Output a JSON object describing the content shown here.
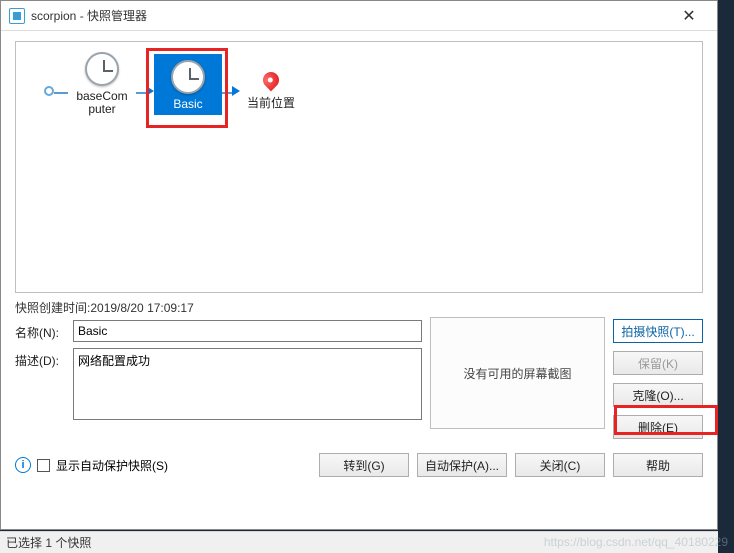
{
  "window": {
    "title": "scorpion - 快照管理器",
    "close": "✕"
  },
  "tree": {
    "node1_label": "baseCom\nputer",
    "node2_label": "Basic",
    "current_label": "当前位置"
  },
  "details": {
    "created_prefix": "快照创建时间:",
    "created_time": "2019/8/20 17:09:17",
    "name_label": "名称(N):",
    "name_value": "Basic",
    "desc_label": "描述(D):",
    "desc_value": "网络配置成功",
    "no_screenshot": "没有可用的屏幕截图"
  },
  "side": {
    "take": "拍摄快照(T)...",
    "keep": "保留(K)",
    "clone": "克隆(O)...",
    "delete": "删除(E)"
  },
  "footer": {
    "auto_label": "显示自动保护快照(S)",
    "goto": "转到(G)",
    "autoprotect": "自动保护(A)...",
    "close": "关闭(C)",
    "help": "帮助"
  },
  "status": "已选择 1 个快照",
  "watermark": "https://blog.csdn.net/qq_40180229"
}
